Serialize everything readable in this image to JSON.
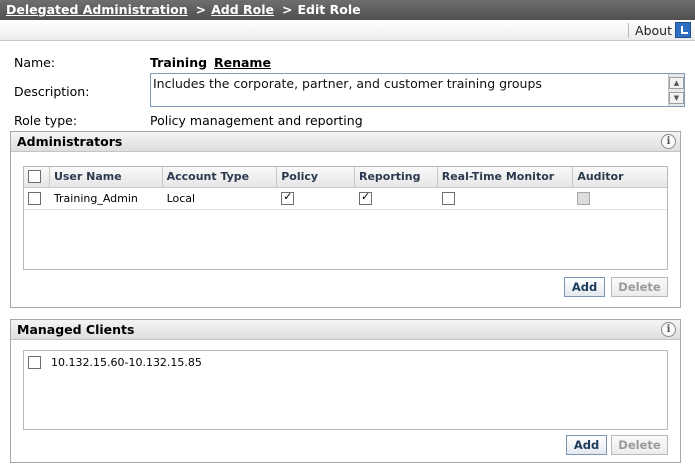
{
  "breadcrumb": {
    "items": [
      {
        "label": "Delegated Administration"
      },
      {
        "label": "Add Role"
      },
      {
        "label": "Edit Role"
      }
    ],
    "separator": ">"
  },
  "about": {
    "label": "About"
  },
  "form": {
    "name_label": "Name:",
    "name_value": "Training",
    "rename_label": "Rename",
    "description_label": "Description:",
    "description_value": "Includes the corporate, partner, and customer training groups",
    "role_type_label": "Role type:",
    "role_type_value": "Policy management and reporting"
  },
  "administrators": {
    "title": "Administrators",
    "columns": [
      "User Name",
      "Account Type",
      "Policy",
      "Reporting",
      "Real-Time Monitor",
      "Auditor"
    ],
    "rows": [
      {
        "user_name": "Training_Admin",
        "account_type": "Local",
        "policy": true,
        "reporting": true,
        "real_time_monitor": false,
        "auditor": false
      }
    ],
    "add_label": "Add",
    "delete_label": "Delete"
  },
  "managed_clients": {
    "title": "Managed Clients",
    "items": [
      "10.132.15.60-10.132.15.85"
    ],
    "add_label": "Add",
    "delete_label": "Delete"
  },
  "colors": {
    "breadcrumb_bg": "#5f5f5f",
    "grid_header_text": "#2b3a4e",
    "button_text": "#1f3b5c",
    "about_icon": "#2f6fc0"
  }
}
